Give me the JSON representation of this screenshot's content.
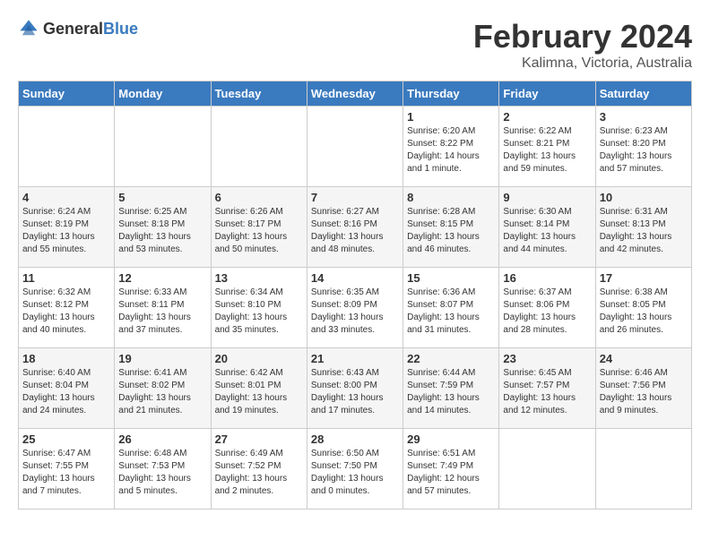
{
  "app": {
    "name": "GeneralBlue",
    "logo_text_1": "General",
    "logo_text_2": "Blue"
  },
  "calendar": {
    "title": "February 2024",
    "subtitle": "Kalimna, Victoria, Australia",
    "days_of_week": [
      "Sunday",
      "Monday",
      "Tuesday",
      "Wednesday",
      "Thursday",
      "Friday",
      "Saturday"
    ],
    "weeks": [
      [
        {
          "day": "",
          "info": ""
        },
        {
          "day": "",
          "info": ""
        },
        {
          "day": "",
          "info": ""
        },
        {
          "day": "",
          "info": ""
        },
        {
          "day": "1",
          "info": "Sunrise: 6:20 AM\nSunset: 8:22 PM\nDaylight: 14 hours and 1 minute."
        },
        {
          "day": "2",
          "info": "Sunrise: 6:22 AM\nSunset: 8:21 PM\nDaylight: 13 hours and 59 minutes."
        },
        {
          "day": "3",
          "info": "Sunrise: 6:23 AM\nSunset: 8:20 PM\nDaylight: 13 hours and 57 minutes."
        }
      ],
      [
        {
          "day": "4",
          "info": "Sunrise: 6:24 AM\nSunset: 8:19 PM\nDaylight: 13 hours and 55 minutes."
        },
        {
          "day": "5",
          "info": "Sunrise: 6:25 AM\nSunset: 8:18 PM\nDaylight: 13 hours and 53 minutes."
        },
        {
          "day": "6",
          "info": "Sunrise: 6:26 AM\nSunset: 8:17 PM\nDaylight: 13 hours and 50 minutes."
        },
        {
          "day": "7",
          "info": "Sunrise: 6:27 AM\nSunset: 8:16 PM\nDaylight: 13 hours and 48 minutes."
        },
        {
          "day": "8",
          "info": "Sunrise: 6:28 AM\nSunset: 8:15 PM\nDaylight: 13 hours and 46 minutes."
        },
        {
          "day": "9",
          "info": "Sunrise: 6:30 AM\nSunset: 8:14 PM\nDaylight: 13 hours and 44 minutes."
        },
        {
          "day": "10",
          "info": "Sunrise: 6:31 AM\nSunset: 8:13 PM\nDaylight: 13 hours and 42 minutes."
        }
      ],
      [
        {
          "day": "11",
          "info": "Sunrise: 6:32 AM\nSunset: 8:12 PM\nDaylight: 13 hours and 40 minutes."
        },
        {
          "day": "12",
          "info": "Sunrise: 6:33 AM\nSunset: 8:11 PM\nDaylight: 13 hours and 37 minutes."
        },
        {
          "day": "13",
          "info": "Sunrise: 6:34 AM\nSunset: 8:10 PM\nDaylight: 13 hours and 35 minutes."
        },
        {
          "day": "14",
          "info": "Sunrise: 6:35 AM\nSunset: 8:09 PM\nDaylight: 13 hours and 33 minutes."
        },
        {
          "day": "15",
          "info": "Sunrise: 6:36 AM\nSunset: 8:07 PM\nDaylight: 13 hours and 31 minutes."
        },
        {
          "day": "16",
          "info": "Sunrise: 6:37 AM\nSunset: 8:06 PM\nDaylight: 13 hours and 28 minutes."
        },
        {
          "day": "17",
          "info": "Sunrise: 6:38 AM\nSunset: 8:05 PM\nDaylight: 13 hours and 26 minutes."
        }
      ],
      [
        {
          "day": "18",
          "info": "Sunrise: 6:40 AM\nSunset: 8:04 PM\nDaylight: 13 hours and 24 minutes."
        },
        {
          "day": "19",
          "info": "Sunrise: 6:41 AM\nSunset: 8:02 PM\nDaylight: 13 hours and 21 minutes."
        },
        {
          "day": "20",
          "info": "Sunrise: 6:42 AM\nSunset: 8:01 PM\nDaylight: 13 hours and 19 minutes."
        },
        {
          "day": "21",
          "info": "Sunrise: 6:43 AM\nSunset: 8:00 PM\nDaylight: 13 hours and 17 minutes."
        },
        {
          "day": "22",
          "info": "Sunrise: 6:44 AM\nSunset: 7:59 PM\nDaylight: 13 hours and 14 minutes."
        },
        {
          "day": "23",
          "info": "Sunrise: 6:45 AM\nSunset: 7:57 PM\nDaylight: 13 hours and 12 minutes."
        },
        {
          "day": "24",
          "info": "Sunrise: 6:46 AM\nSunset: 7:56 PM\nDaylight: 13 hours and 9 minutes."
        }
      ],
      [
        {
          "day": "25",
          "info": "Sunrise: 6:47 AM\nSunset: 7:55 PM\nDaylight: 13 hours and 7 minutes."
        },
        {
          "day": "26",
          "info": "Sunrise: 6:48 AM\nSunset: 7:53 PM\nDaylight: 13 hours and 5 minutes."
        },
        {
          "day": "27",
          "info": "Sunrise: 6:49 AM\nSunset: 7:52 PM\nDaylight: 13 hours and 2 minutes."
        },
        {
          "day": "28",
          "info": "Sunrise: 6:50 AM\nSunset: 7:50 PM\nDaylight: 13 hours and 0 minutes."
        },
        {
          "day": "29",
          "info": "Sunrise: 6:51 AM\nSunset: 7:49 PM\nDaylight: 12 hours and 57 minutes."
        },
        {
          "day": "",
          "info": ""
        },
        {
          "day": "",
          "info": ""
        }
      ]
    ]
  }
}
